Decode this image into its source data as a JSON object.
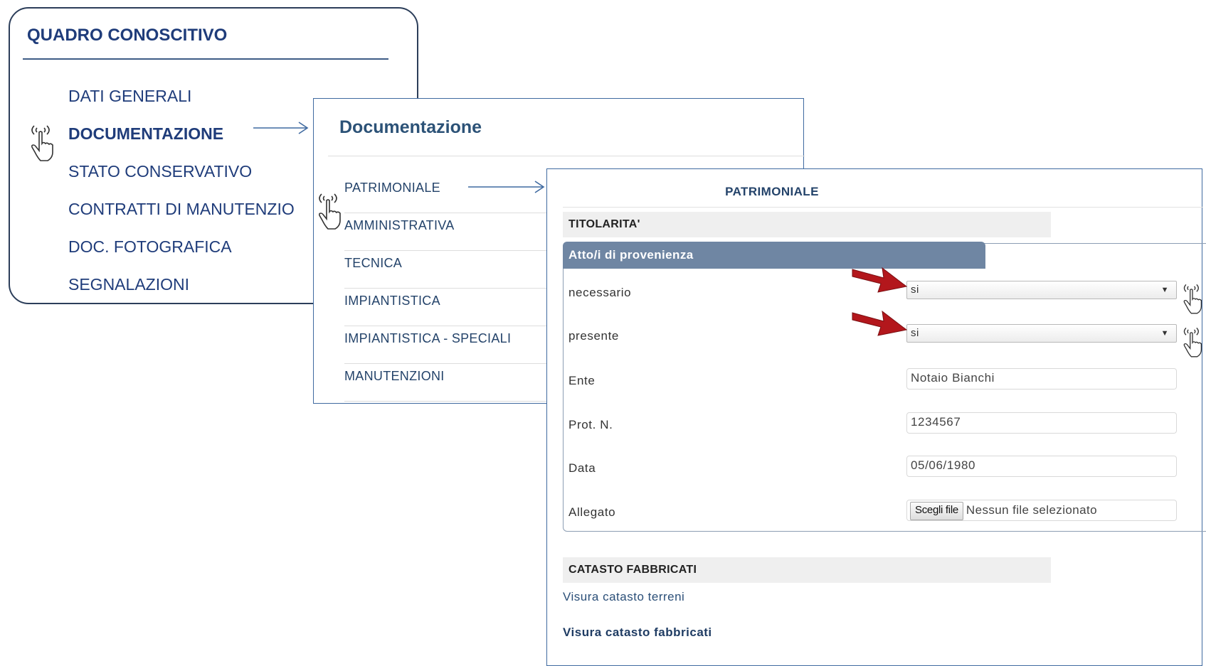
{
  "quadro": {
    "title": "QUADRO CONOSCITIVO",
    "items": [
      {
        "label": "DATI GENERALI",
        "active": false
      },
      {
        "label": "DOCUMENTAZIONE",
        "active": true
      },
      {
        "label": "STATO CONSERVATIVO",
        "active": false
      },
      {
        "label": "CONTRATTI DI MANUTENZIO",
        "active": false
      },
      {
        "label": "DOC. FOTOGRAFICA",
        "active": false
      },
      {
        "label": "SEGNALAZIONI",
        "active": false
      }
    ]
  },
  "documentazione": {
    "title": "Documentazione",
    "items": [
      {
        "label": "PATRIMONIALE"
      },
      {
        "label": "AMMINISTRATIVA"
      },
      {
        "label": "TECNICA"
      },
      {
        "label": "IMPIANTISTICA"
      },
      {
        "label": "IMPIANTISTICA - SPECIALI"
      },
      {
        "label": "MANUTENZIONI"
      }
    ]
  },
  "patrimoniale": {
    "title": "PATRIMONIALE",
    "titolarita": "TITOLARITA'",
    "legend": "Atto/i di provenienza",
    "fields": {
      "necessario": {
        "label": "necessario",
        "value": "si"
      },
      "presente": {
        "label": "presente",
        "value": "si"
      },
      "ente": {
        "label": "Ente",
        "value": "Notaio Bianchi"
      },
      "prot": {
        "label": "Prot. N.",
        "value": "1234567"
      },
      "data": {
        "label": "Data",
        "value": "05/06/1980"
      },
      "allegato": {
        "label": "Allegato",
        "button": "Scegli file",
        "status": "Nessun file selezionato"
      }
    },
    "catasto_title": "CATASTO FABBRICATI",
    "link_terreni": "Visura catasto terreni",
    "link_fabbricati": "Visura catasto fabbricati"
  },
  "icons": {
    "hand": "hand-pointer-icon",
    "arrow": "arrow-right-icon",
    "red_arrow": "red-arrow-icon",
    "caret": "caret-down-icon"
  },
  "colors": {
    "navy": "#1f3c7a",
    "legend_bg": "#6f86a3",
    "red_arrow": "#b3171c"
  }
}
